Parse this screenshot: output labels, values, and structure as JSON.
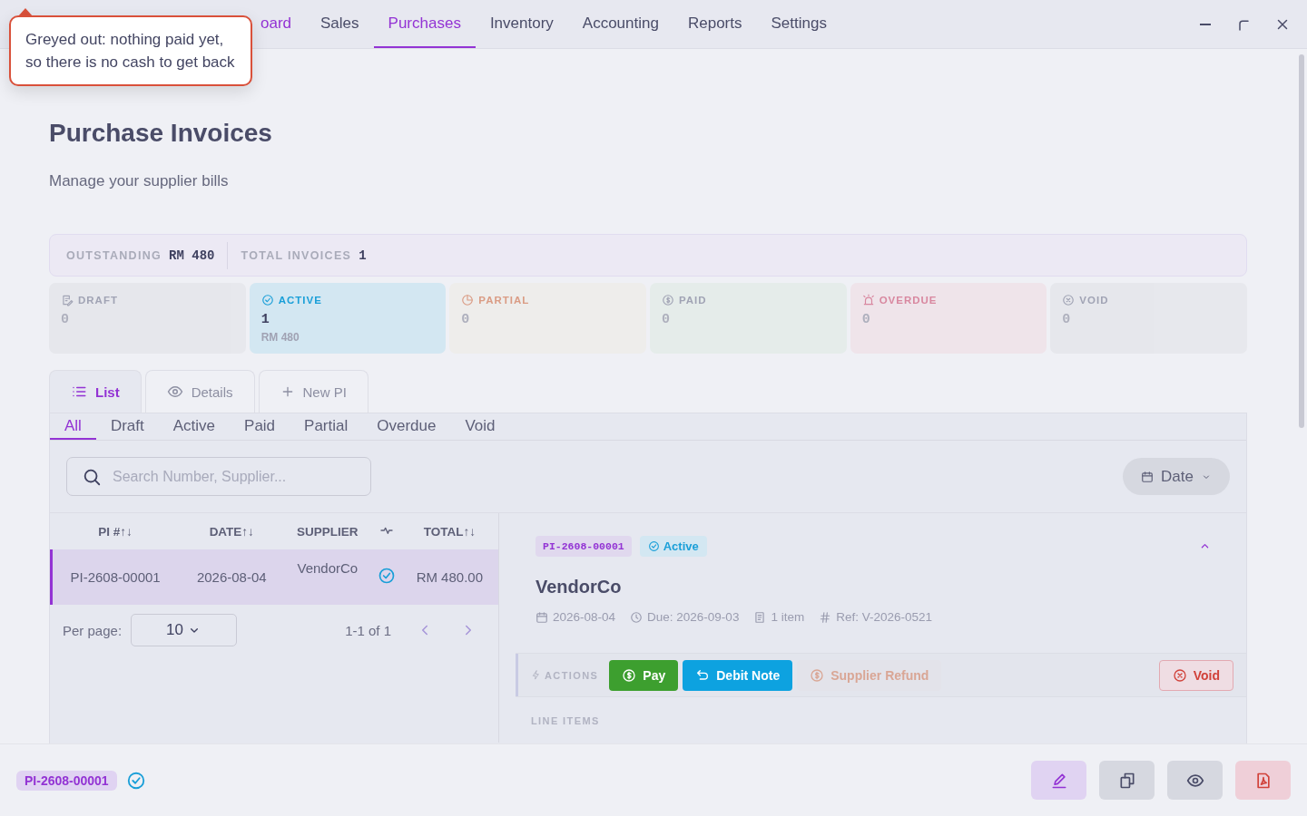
{
  "nav": {
    "tabs": [
      {
        "label": "oard",
        "selected": false
      },
      {
        "label": "Sales",
        "selected": false
      },
      {
        "label": "Purchases",
        "selected": true
      },
      {
        "label": "Inventory",
        "selected": false
      },
      {
        "label": "Accounting",
        "selected": false
      },
      {
        "label": "Reports",
        "selected": false
      },
      {
        "label": "Settings",
        "selected": false
      }
    ]
  },
  "tooltip": {
    "text": "Greyed out: nothing paid yet, so there is no cash to get back"
  },
  "page": {
    "title": "Purchase Invoices",
    "subtitle": "Manage your supplier bills"
  },
  "summary": [
    {
      "label": "OUTSTANDING",
      "value": "RM 480"
    },
    {
      "label": "TOTAL INVOICES",
      "value": "1"
    }
  ],
  "status_cards": [
    {
      "kind": "draft",
      "label": "DRAFT",
      "count": "0",
      "color": "#9a9daf",
      "selected": false
    },
    {
      "kind": "active",
      "label": "ACTIVE",
      "count": "1",
      "amount": "RM 480",
      "color": "#1a9fd8",
      "selected": true
    },
    {
      "kind": "partial",
      "label": "PARTIAL",
      "count": "0",
      "color": "#d9957b",
      "selected": false
    },
    {
      "kind": "paid",
      "label": "PAID",
      "count": "0",
      "color": "#9a9daf",
      "selected": false
    },
    {
      "kind": "overdue",
      "label": "OVERDUE",
      "count": "0",
      "color": "#d77f98",
      "selected": false
    },
    {
      "kind": "void",
      "label": "VOID",
      "count": "0",
      "color": "#9a9daf",
      "selected": false
    }
  ],
  "view_tabs": [
    {
      "kind": "list",
      "label": "List",
      "selected": true
    },
    {
      "kind": "details",
      "label": "Details",
      "selected": false
    },
    {
      "kind": "new",
      "label": "New PI",
      "selected": false
    }
  ],
  "filter_tabs": [
    {
      "label": "All",
      "selected": true
    },
    {
      "label": "Draft",
      "selected": false
    },
    {
      "label": "Active",
      "selected": false
    },
    {
      "label": "Paid",
      "selected": false
    },
    {
      "label": "Partial",
      "selected": false
    },
    {
      "label": "Overdue",
      "selected": false
    },
    {
      "label": "Void",
      "selected": false
    }
  ],
  "search": {
    "placeholder": "Search Number, Supplier..."
  },
  "date_button": {
    "label": "Date"
  },
  "table": {
    "columns": [
      {
        "kind": "text",
        "label": "PI #↑↓"
      },
      {
        "kind": "text",
        "label": "DATE↑↓"
      },
      {
        "kind": "text",
        "label": "SUPPLIER"
      },
      {
        "kind": "icon"
      },
      {
        "kind": "text",
        "label": "TOTAL↑↓"
      }
    ],
    "rows": [
      {
        "number": "PI-2608-00001",
        "date": "2026-08-04",
        "supplier": "VendorCo",
        "kind": "active",
        "total": "RM 480.00",
        "selected": true
      }
    ]
  },
  "pagination": {
    "per_page_label": "Per page:",
    "per_page": "10",
    "range": "1-1 of 1"
  },
  "detail": {
    "number": "PI-2608-00001",
    "status": "Active",
    "supplier": "VendorCo",
    "meta": [
      {
        "kind": "date",
        "text": "2026-08-04"
      },
      {
        "kind": "due",
        "text": "Due: 2026-09-03"
      },
      {
        "kind": "items",
        "text": "1 item"
      },
      {
        "kind": "ref",
        "text": "Ref: V-2026-0521"
      }
    ],
    "actions_label": "ACTIONS",
    "actions": [
      {
        "kind": "pay",
        "label": "Pay",
        "disabled": false
      },
      {
        "kind": "debit",
        "label": "Debit Note",
        "disabled": false
      },
      {
        "kind": "refund",
        "label": "Supplier Refund",
        "disabled": true
      },
      {
        "kind": "void",
        "label": "Void",
        "disabled": false
      }
    ],
    "line_items_label": "LINE ITEMS"
  },
  "footer": {
    "number": "PI-2608-00001"
  }
}
